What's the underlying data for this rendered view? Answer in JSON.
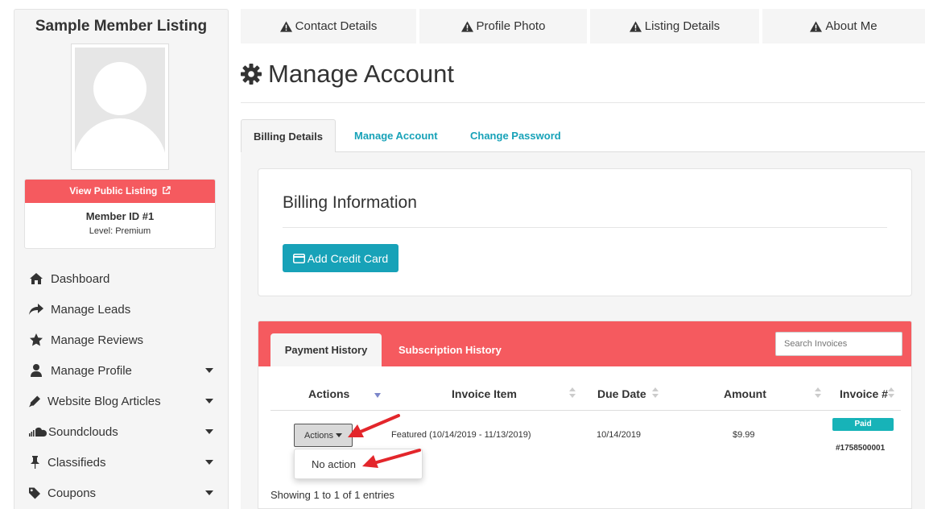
{
  "sidebar": {
    "site_title": "Sample Member Listing",
    "public_listing_label": "View Public Listing",
    "member_id": "Member ID #1",
    "level": "Level: Premium",
    "items": [
      {
        "label": "Dashboard",
        "icon": "home-icon",
        "has_caret": false
      },
      {
        "label": "Manage Leads",
        "icon": "share-arrow-icon",
        "has_caret": false
      },
      {
        "label": "Manage Reviews",
        "icon": "star-icon",
        "has_caret": false
      },
      {
        "label": "Manage Profile",
        "icon": "user-icon",
        "has_caret": true
      },
      {
        "label": "Website Blog Articles",
        "icon": "pencil-icon",
        "has_caret": true
      },
      {
        "label": "Soundclouds",
        "icon": "soundcloud-icon",
        "has_caret": true
      },
      {
        "label": "Classifieds",
        "icon": "thumbtack-icon",
        "has_caret": true
      },
      {
        "label": "Coupons",
        "icon": "tag-icon",
        "has_caret": true
      }
    ]
  },
  "top_tabs": [
    {
      "label": "Contact Details",
      "icon": "warning-icon"
    },
    {
      "label": "Profile Photo",
      "icon": "warning-icon"
    },
    {
      "label": "Listing Details",
      "icon": "warning-icon"
    },
    {
      "label": "About Me",
      "icon": "warning-icon"
    }
  ],
  "page": {
    "title": "Manage Account",
    "title_icon": "gear-icon"
  },
  "sub_tabs": [
    {
      "label": "Billing Details",
      "active": true
    },
    {
      "label": "Manage Account",
      "active": false
    },
    {
      "label": "Change Password",
      "active": false
    }
  ],
  "billing": {
    "title": "Billing Information",
    "add_card_label": "Add Credit Card"
  },
  "history": {
    "tabs": [
      {
        "label": "Payment History",
        "active": true
      },
      {
        "label": "Subscription History",
        "active": false
      }
    ],
    "search_placeholder": "Search Invoices",
    "columns": [
      "Actions",
      "Invoice Item",
      "Due Date",
      "Amount",
      "Invoice #"
    ],
    "rows": [
      {
        "action_label": "Actions",
        "invoice_item": "Featured (10/14/2019 - 11/13/2019)",
        "due_date": "10/14/2019",
        "amount": "$9.99",
        "status": "Paid",
        "invoice_no": "#1758500001"
      }
    ],
    "dropdown_option": "No action",
    "showing": "Showing 1 to 1 of 1 entries"
  },
  "colors": {
    "accent_red": "#f55a5f",
    "accent_teal": "#17a2b8",
    "annotation_arrow": "#e3262b"
  }
}
